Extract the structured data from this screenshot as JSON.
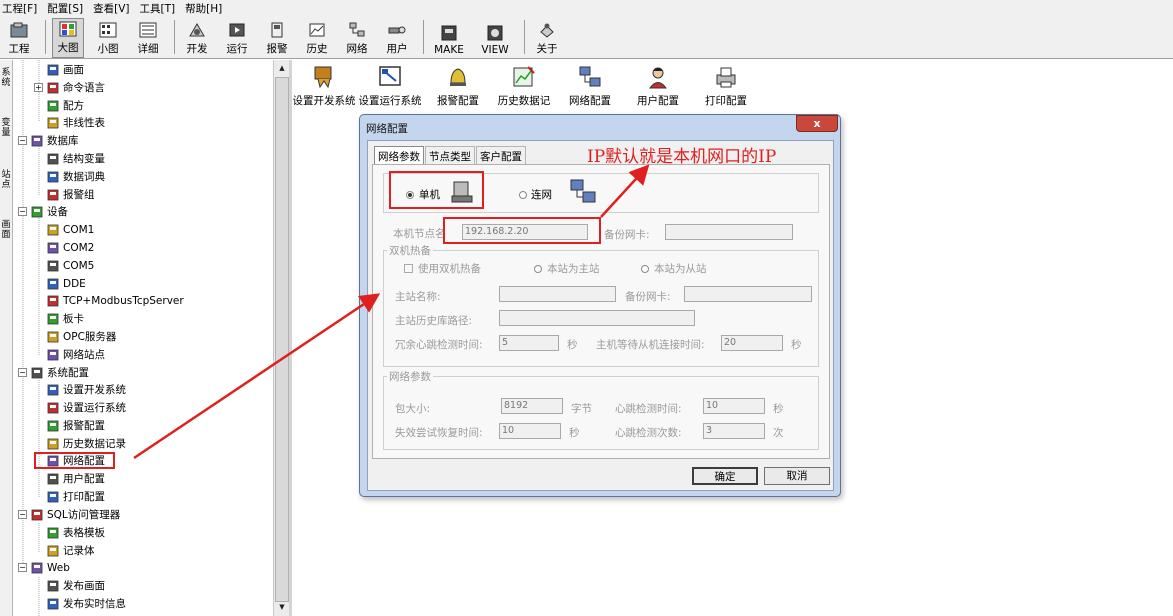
{
  "menubar": [
    "工程[F]",
    "配置[S]",
    "查看[V]",
    "工具[T]",
    "帮助[H]"
  ],
  "toolbar": [
    {
      "label": "工程",
      "icon": "project-icon"
    },
    {
      "label": "大图",
      "icon": "large-icons-icon",
      "active": true
    },
    {
      "label": "小图",
      "icon": "small-icons-icon"
    },
    {
      "label": "详细",
      "icon": "details-icon"
    },
    {
      "label": "开发",
      "icon": "develop-icon"
    },
    {
      "label": "运行",
      "icon": "run-icon"
    },
    {
      "label": "报警",
      "icon": "alarm-icon"
    },
    {
      "label": "历史",
      "icon": "history-icon"
    },
    {
      "label": "网络",
      "icon": "network-icon"
    },
    {
      "label": "用户",
      "icon": "user-icon"
    },
    {
      "label": "MAKE",
      "icon": "make-icon"
    },
    {
      "label": "VIEW",
      "icon": "view-icon"
    },
    {
      "label": "关于",
      "icon": "about-icon"
    }
  ],
  "left_tabs": [
    "系统",
    "变量",
    "站点",
    "画面"
  ],
  "tree": [
    {
      "label": "画面",
      "level": 2,
      "icon": "screen-icon"
    },
    {
      "label": "命令语言",
      "level": 2,
      "icon": "command-icon",
      "expander": "+"
    },
    {
      "label": "配方",
      "level": 2,
      "icon": "recipe-icon"
    },
    {
      "label": "非线性表",
      "level": 2,
      "icon": "table-icon"
    },
    {
      "label": "数据库",
      "level": 1,
      "icon": "database-icon",
      "expander": "−"
    },
    {
      "label": "结构变量",
      "level": 2,
      "icon": "struct-var-icon"
    },
    {
      "label": "数据词典",
      "level": 2,
      "icon": "dictionary-icon"
    },
    {
      "label": "报警组",
      "level": 2,
      "icon": "alarm-group-icon"
    },
    {
      "label": "设备",
      "level": 1,
      "icon": "device-icon",
      "expander": "−"
    },
    {
      "label": "COM1",
      "level": 2,
      "icon": "com-port-icon"
    },
    {
      "label": "COM2",
      "level": 2,
      "icon": "com-port-icon"
    },
    {
      "label": "COM5",
      "level": 2,
      "icon": "com-port-icon"
    },
    {
      "label": "DDE",
      "level": 2,
      "icon": "dde-icon"
    },
    {
      "label": "TCP+ModbusTcpServer",
      "level": 2,
      "icon": "tcp-server-icon"
    },
    {
      "label": "板卡",
      "level": 2,
      "icon": "board-icon"
    },
    {
      "label": "OPC服务器",
      "level": 2,
      "icon": "opc-server-icon"
    },
    {
      "label": "网络站点",
      "level": 2,
      "icon": "network-site-icon"
    },
    {
      "label": "系统配置",
      "level": 1,
      "icon": "tools-icon",
      "expander": "−"
    },
    {
      "label": "设置开发系统",
      "level": 2,
      "icon": "dev-settings-icon"
    },
    {
      "label": "设置运行系统",
      "level": 2,
      "icon": "run-settings-icon"
    },
    {
      "label": "报警配置",
      "level": 2,
      "icon": "alarm-config-icon"
    },
    {
      "label": "历史数据记录",
      "level": 2,
      "icon": "history-record-icon"
    },
    {
      "label": "网络配置",
      "level": 2,
      "icon": "network-config-icon",
      "selected": true
    },
    {
      "label": "用户配置",
      "level": 2,
      "icon": "user-config-icon"
    },
    {
      "label": "打印配置",
      "level": 2,
      "icon": "print-config-icon"
    },
    {
      "label": "SQL访问管理器",
      "level": 1,
      "icon": "sql-icon",
      "expander": "−"
    },
    {
      "label": "表格模板",
      "level": 2,
      "icon": "table-template-icon"
    },
    {
      "label": "记录体",
      "level": 2,
      "icon": "record-icon"
    },
    {
      "label": "Web",
      "level": 1,
      "icon": "folder-icon",
      "expander": "−"
    },
    {
      "label": "发布画面",
      "level": 2,
      "icon": "publish-screen-icon"
    },
    {
      "label": "发布实时信息",
      "level": 2,
      "icon": "publish-info-icon"
    }
  ],
  "content_icons": [
    {
      "label": "设置开发系统",
      "icon": "dev-settings-icon"
    },
    {
      "label": "设置运行系统",
      "icon": "run-settings-icon"
    },
    {
      "label": "报警配置",
      "icon": "alarm-config-icon"
    },
    {
      "label": "历史数据记",
      "icon": "history-record-icon"
    },
    {
      "label": "网络配置",
      "icon": "network-config-icon"
    },
    {
      "label": "用户配置",
      "icon": "user-config-icon"
    },
    {
      "label": "打印配置",
      "icon": "print-config-icon"
    }
  ],
  "dialog": {
    "title": "网络配置",
    "close": "x",
    "tabs": [
      "网络参数",
      "节点类型",
      "客户配置"
    ],
    "mode_standalone": "单机",
    "mode_network": "连网",
    "node_name_label": "本机节点名",
    "node_name_value": "192.168.2.20",
    "backup_nic_label": "备份网卡:",
    "hot_standby": {
      "group": "双机热备",
      "use_label": "使用双机热备",
      "primary_label": "本站为主站",
      "secondary_label": "本站为从站",
      "primary_name_label": "主站名称:",
      "backup_nic_label": "备份网卡:",
      "history_path_label": "主站历史库路径:",
      "heartbeat_label": "冗余心跳检测时间:",
      "heartbeat_value": "5",
      "heartbeat_unit": "秒",
      "wait_label": "主机等待从机连接时间:",
      "wait_value": "20",
      "wait_unit": "秒"
    },
    "net_params": {
      "group": "网络参数",
      "packet_label": "包大小:",
      "packet_value": "8192",
      "packet_unit": "字节",
      "hb_label": "心跳检测时间:",
      "hb_value": "10",
      "hb_unit": "秒",
      "retry_label": "失效尝试恢复时间:",
      "retry_value": "10",
      "retry_unit": "秒",
      "hbcount_label": "心跳检测次数:",
      "hbcount_value": "3",
      "hbcount_unit": "次"
    },
    "ok": "确定",
    "cancel": "取消"
  },
  "annotation": "IP默认就是本机网口的IP",
  "colors": {
    "annotation": "#e02020",
    "dialog_frame": "#c3d6ee",
    "close_button": "#c9483b"
  }
}
